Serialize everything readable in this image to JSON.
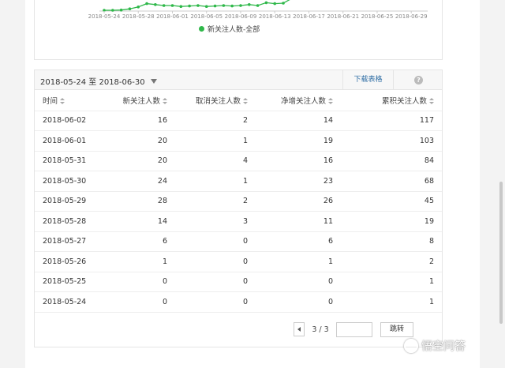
{
  "chart": {
    "x_ticks": [
      "2018-05-24",
      "2018-05-28",
      "2018-06-01",
      "2018-06-05",
      "2018-06-09",
      "2018-06-13",
      "2018-06-17",
      "2018-06-21",
      "2018-06-25",
      "2018-06-29"
    ],
    "legend_label": "新关注人数-全部",
    "series_color": "#2fb84a"
  },
  "chart_data": {
    "type": "line",
    "x": [
      "2018-05-24",
      "2018-05-25",
      "2018-05-26",
      "2018-05-27",
      "2018-05-28",
      "2018-05-29",
      "2018-05-30",
      "2018-05-31",
      "2018-06-01",
      "2018-06-02",
      "2018-06-03",
      "2018-06-04",
      "2018-06-05",
      "2018-06-06",
      "2018-06-07",
      "2018-06-08",
      "2018-06-09",
      "2018-06-10",
      "2018-06-11",
      "2018-06-12",
      "2018-06-13",
      "2018-06-14",
      "2018-06-15"
    ],
    "series": [
      {
        "name": "新关注人数-全部",
        "values": [
          0,
          0,
          1,
          6,
          14,
          28,
          24,
          20,
          20,
          16,
          18,
          20,
          16,
          18,
          20,
          18,
          20,
          24,
          20,
          32,
          28,
          30,
          60
        ]
      }
    ],
    "x_ticks": [
      "2018-05-24",
      "2018-05-28",
      "2018-06-01",
      "2018-06-05",
      "2018-06-09",
      "2018-06-13",
      "2018-06-17",
      "2018-06-21",
      "2018-06-25",
      "2018-06-29"
    ],
    "legend": "bottom-center"
  },
  "toolbar": {
    "date_range": "2018-05-24 至 2018-06-30",
    "download_label": "下载表格",
    "help_label": "?"
  },
  "table": {
    "headers": [
      "时间",
      "新关注人数",
      "取消关注人数",
      "净增关注人数",
      "累积关注人数"
    ],
    "rows": [
      [
        "2018-06-02",
        "16",
        "2",
        "14",
        "117"
      ],
      [
        "2018-06-01",
        "20",
        "1",
        "19",
        "103"
      ],
      [
        "2018-05-31",
        "20",
        "4",
        "16",
        "84"
      ],
      [
        "2018-05-30",
        "24",
        "1",
        "23",
        "68"
      ],
      [
        "2018-05-29",
        "28",
        "2",
        "26",
        "45"
      ],
      [
        "2018-05-28",
        "14",
        "3",
        "11",
        "19"
      ],
      [
        "2018-05-27",
        "6",
        "0",
        "6",
        "8"
      ],
      [
        "2018-05-26",
        "1",
        "0",
        "1",
        "2"
      ],
      [
        "2018-05-25",
        "0",
        "0",
        "0",
        "1"
      ],
      [
        "2018-05-24",
        "0",
        "0",
        "0",
        "1"
      ]
    ]
  },
  "pager": {
    "page_info": "3 / 3",
    "input_value": "",
    "jump_label": "跳转"
  },
  "watermark": {
    "text": "悟空问答"
  }
}
